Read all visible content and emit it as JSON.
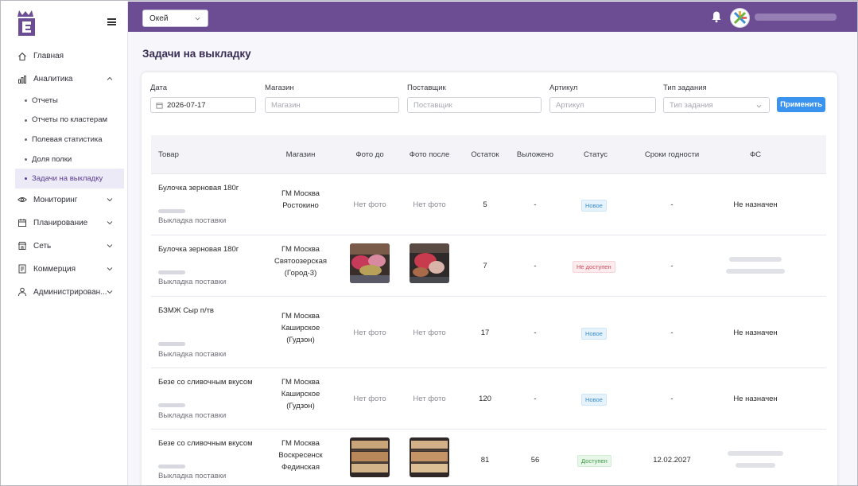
{
  "colors": {
    "brand": "#6c4c93",
    "accent_button": "#3a93ee",
    "active_nav_bg": "#eceaf7",
    "status_new": "#3a8bd0",
    "status_unavailable": "#d24a5a",
    "status_available": "#3c9b45"
  },
  "sidebar": {
    "items": [
      {
        "label": "Главная",
        "icon": "home-icon",
        "expandable": false
      },
      {
        "label": "Аналитика",
        "icon": "bar-chart-icon",
        "expandable": true,
        "expanded": true,
        "children": [
          "Отчеты",
          "Отчеты по кластерам",
          "Полевая статистика",
          "Доля полки",
          "Задачи на выкладку"
        ],
        "active_child": "Задачи на выкладку"
      },
      {
        "label": "Мониторинг",
        "icon": "eye-icon",
        "expandable": true
      },
      {
        "label": "Планирование",
        "icon": "calendar-icon",
        "expandable": true
      },
      {
        "label": "Сеть",
        "icon": "store-icon",
        "expandable": true
      },
      {
        "label": "Коммерция",
        "icon": "document-icon",
        "expandable": true
      },
      {
        "label": "Администрирован...",
        "icon": "user-icon",
        "expandable": true
      }
    ]
  },
  "header": {
    "store_select": "Окей"
  },
  "page": {
    "title": "Задачи на выкладку"
  },
  "filters": {
    "date": {
      "label": "Дата",
      "value": "2026-07-17"
    },
    "store": {
      "label": "Магазин",
      "placeholder": "Магазин"
    },
    "supplier": {
      "label": "Поставщик",
      "placeholder": "Поставщик"
    },
    "article": {
      "label": "Артикул",
      "placeholder": "Артикул"
    },
    "task_type": {
      "label": "Тип задания",
      "placeholder": "Тип задания"
    },
    "apply_label": "Применить"
  },
  "table": {
    "columns": [
      "Товар",
      "Магазин",
      "Фото до",
      "Фото после",
      "Остаток",
      "Выложено",
      "Статус",
      "Сроки годности",
      "ФС"
    ],
    "rows": [
      {
        "product": "Булочка зерновая 180г",
        "task": "Выкладка поставки",
        "store": "ГМ Москва Ростокино",
        "photo_before": "Нет фото",
        "photo_after": "Нет фото",
        "stock": "5",
        "placed": "-",
        "status": "Новое",
        "status_kind": "new",
        "expiry": "-",
        "fs": "Не назначен"
      },
      {
        "product": "Булочка зерновая 180г",
        "task": "Выкладка поставки",
        "store": "ГМ Москва Святоозерская (Город-3)",
        "photo_before": "photo",
        "photo_after": "photo",
        "stock": "7",
        "placed": "-",
        "status": "Не доступен",
        "status_kind": "na",
        "expiry": "-",
        "fs": ""
      },
      {
        "product": "БЗМЖ Сыр п/тв",
        "task": "Выкладка поставки",
        "store": "ГМ Москва Каширское (Гудзон)",
        "photo_before": "Нет фото",
        "photo_after": "Нет фото",
        "stock": "17",
        "placed": "-",
        "status": "Новое",
        "status_kind": "new",
        "expiry": "-",
        "fs": "Не назначен"
      },
      {
        "product": "Безе со сливочным вкусом",
        "task": "Выкладка поставки",
        "store": "ГМ Москва Каширское (Гудзон)",
        "photo_before": "Нет фото",
        "photo_after": "Нет фото",
        "stock": "120",
        "placed": "-",
        "status": "Новое",
        "status_kind": "new",
        "expiry": "-",
        "fs": "Не назначен"
      },
      {
        "product": "Безе со сливочным вкусом",
        "task": "Выкладка поставки",
        "store": "ГМ Москва Воскресенск Фединская",
        "photo_before": "photo",
        "photo_after": "photo",
        "stock": "81",
        "placed": "56",
        "status": "Доступен",
        "status_kind": "ok",
        "expiry": "12.02.2027",
        "fs": ""
      }
    ]
  }
}
